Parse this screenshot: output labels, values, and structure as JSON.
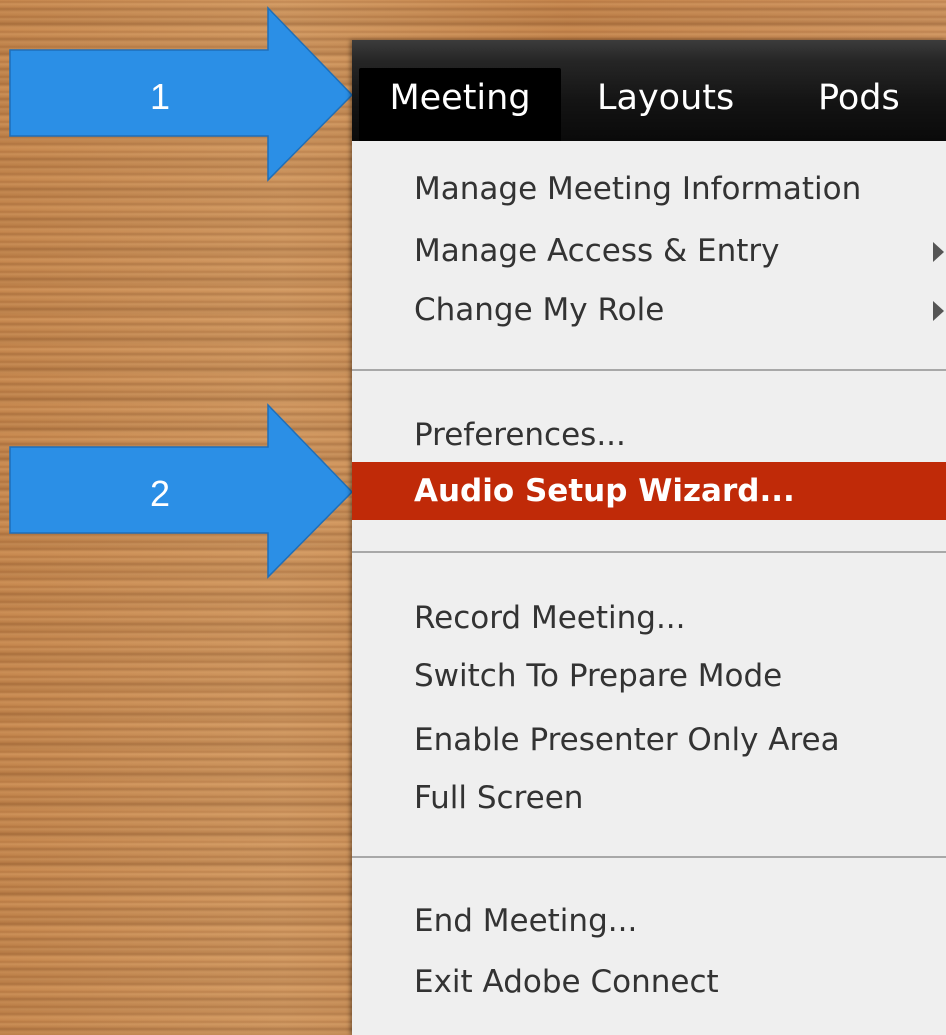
{
  "annotations": {
    "arrow1_label": "1",
    "arrow2_label": "2",
    "arrow_color": "#2b8fe6"
  },
  "menubar": {
    "tabs": [
      {
        "label": "Meeting",
        "active": true
      },
      {
        "label": "Layouts",
        "active": false
      },
      {
        "label": "Pods",
        "active": false
      }
    ]
  },
  "menu": {
    "groups": [
      [
        {
          "label": "Manage Meeting Information",
          "submenu": false
        },
        {
          "label": "Manage Access & Entry",
          "submenu": true
        },
        {
          "label": "Change My Role",
          "submenu": true
        }
      ],
      [
        {
          "label": "Preferences...",
          "submenu": false
        },
        {
          "label": "Audio Setup Wizard...",
          "submenu": false,
          "highlighted": true
        }
      ],
      [
        {
          "label": "Record Meeting...",
          "submenu": false
        },
        {
          "label": "Switch To Prepare Mode",
          "submenu": false
        },
        {
          "label": "Enable Presenter Only Area",
          "submenu": false
        },
        {
          "label": "Full Screen",
          "submenu": false
        }
      ],
      [
        {
          "label": "End Meeting...",
          "submenu": false
        },
        {
          "label": "Exit Adobe Connect",
          "submenu": false
        }
      ]
    ],
    "highlight_color": "#c02a08"
  }
}
